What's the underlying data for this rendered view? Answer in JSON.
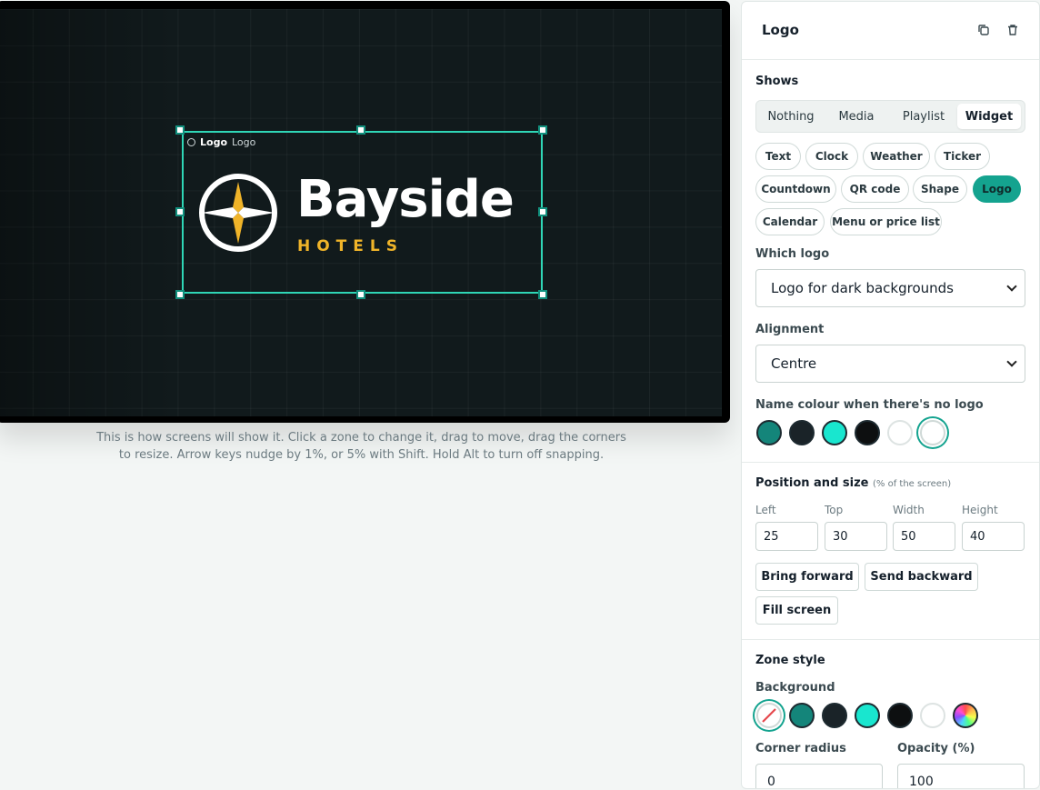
{
  "canvas": {
    "zone_tag": {
      "type": "Logo",
      "name": "Logo"
    },
    "brand": {
      "name": "Bayside",
      "sub": "HOTELS"
    },
    "caption": "This is how screens will show it. Click a zone to change it, drag to move, drag the corners to resize. Arrow keys nudge by 1%, or 5% with Shift. Hold Alt to turn off snapping."
  },
  "panel": {
    "title": "Logo",
    "shows": {
      "title": "Shows",
      "options": [
        "Nothing",
        "Media",
        "Playlist",
        "Widget"
      ],
      "selected": "Widget"
    },
    "widgets": {
      "items": [
        "Text",
        "Clock",
        "Weather",
        "Ticker",
        "Countdown",
        "QR code",
        "Shape",
        "Logo",
        "Calendar",
        "Menu or price list"
      ],
      "selected": "Logo"
    },
    "which_logo": {
      "label": "Which logo",
      "value": "Logo for dark backgrounds"
    },
    "alignment": {
      "label": "Alignment",
      "value": "Centre"
    },
    "name_colour": {
      "label": "Name colour when there's no logo",
      "swatches": [
        "#14857a",
        "#1a2328",
        "#19e6cf",
        "#0d0f10",
        "#ffffff",
        "#ffffff"
      ],
      "selected_index": 5
    },
    "position": {
      "title": "Position and size",
      "subtitle": "(% of the screen)",
      "fields": [
        {
          "label": "Left",
          "value": "25"
        },
        {
          "label": "Top",
          "value": "30"
        },
        {
          "label": "Width",
          "value": "50"
        },
        {
          "label": "Height",
          "value": "40"
        }
      ],
      "buttons": {
        "forward": "Bring forward",
        "backward": "Send backward",
        "fill": "Fill screen"
      }
    },
    "zone_style": {
      "title": "Zone style",
      "background_label": "Background",
      "swatches": [
        "none",
        "#14857a",
        "#1a2328",
        "#19e6cf",
        "#0d0f10",
        "#ffffff",
        "rainbow"
      ],
      "selected_index": 0,
      "corner_radius": {
        "label": "Corner radius",
        "value": "0"
      },
      "opacity": {
        "label": "Opacity (%)",
        "value": "100"
      }
    }
  }
}
